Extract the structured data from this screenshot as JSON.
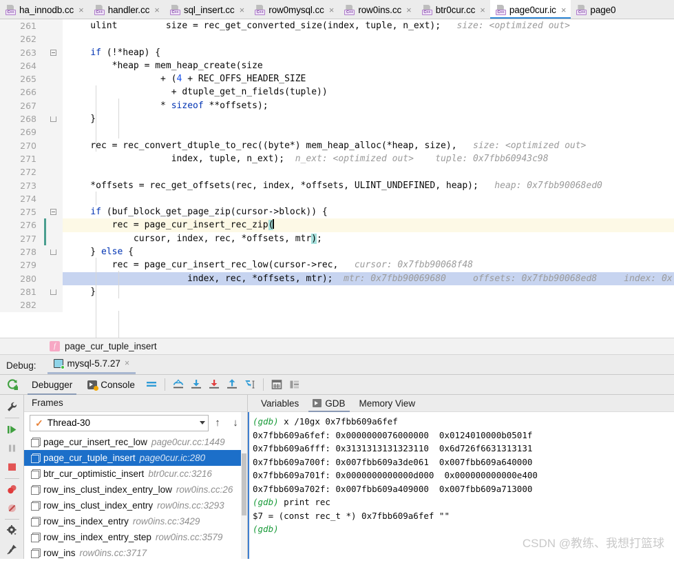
{
  "editor_tabs": [
    {
      "label": "ha_innodb.cc",
      "active": false,
      "closable": true
    },
    {
      "label": "handler.cc",
      "active": false,
      "closable": true
    },
    {
      "label": "sql_insert.cc",
      "active": false,
      "closable": true
    },
    {
      "label": "row0mysql.cc",
      "active": false,
      "closable": true
    },
    {
      "label": "row0ins.cc",
      "active": false,
      "closable": true
    },
    {
      "label": "btr0cur.cc",
      "active": false,
      "closable": true
    },
    {
      "label": "page0cur.ic",
      "active": true,
      "closable": true
    },
    {
      "label": "page0",
      "active": false,
      "closable": false
    }
  ],
  "tab_icon_name": "cpp-file-icon",
  "tab_close_glyph": "×",
  "code": {
    "lines": [
      {
        "n": "261",
        "segments": [
          {
            "t": "    ulint         ",
            "c": "plain"
          },
          {
            "t": "size = rec_get_converted_size(index, tuple, n_ext);",
            "c": "plain"
          },
          {
            "t": "   size: <optimized out>",
            "c": "hint"
          }
        ]
      },
      {
        "n": "262",
        "segments": []
      },
      {
        "n": "263",
        "segments": [
          {
            "t": "    ",
            "c": "plain"
          },
          {
            "t": "if",
            "c": "kw"
          },
          {
            "t": " (!*heap) {",
            "c": "plain"
          }
        ],
        "fold": "open"
      },
      {
        "n": "264",
        "segments": [
          {
            "t": "        *heap = mem_heap_create(size",
            "c": "plain"
          }
        ]
      },
      {
        "n": "265",
        "segments": [
          {
            "t": "                 + (",
            "c": "plain"
          },
          {
            "t": "4",
            "c": "num"
          },
          {
            "t": " + REC_OFFS_HEADER_SIZE",
            "c": "plain"
          }
        ]
      },
      {
        "n": "266",
        "segments": [
          {
            "t": "                   + dtuple_get_n_fields(tuple))",
            "c": "plain"
          }
        ]
      },
      {
        "n": "267",
        "segments": [
          {
            "t": "                 * ",
            "c": "plain"
          },
          {
            "t": "sizeof",
            "c": "kw"
          },
          {
            "t": " **offsets);",
            "c": "plain"
          }
        ]
      },
      {
        "n": "268",
        "segments": [
          {
            "t": "    }",
            "c": "plain"
          }
        ],
        "fold": "end"
      },
      {
        "n": "269",
        "segments": []
      },
      {
        "n": "270",
        "segments": [
          {
            "t": "    rec = rec_convert_dtuple_to_rec((byte*) mem_heap_alloc(*heap, size),",
            "c": "plain"
          },
          {
            "t": "   size: <optimized out>",
            "c": "hint"
          }
        ]
      },
      {
        "n": "271",
        "segments": [
          {
            "t": "                   index, tuple, n_ext);",
            "c": "plain"
          },
          {
            "t": "  n_ext: <optimized out>    tuple: 0x7fbb60943c98",
            "c": "hint"
          }
        ]
      },
      {
        "n": "272",
        "segments": []
      },
      {
        "n": "273",
        "segments": [
          {
            "t": "    *offsets = rec_get_offsets(rec, index, *offsets, ULINT_UNDEFINED, heap);",
            "c": "plain"
          },
          {
            "t": "   heap: 0x7fbb90068ed0",
            "c": "hint"
          }
        ]
      },
      {
        "n": "274",
        "segments": []
      },
      {
        "n": "275",
        "segments": [
          {
            "t": "    ",
            "c": "plain"
          },
          {
            "t": "if",
            "c": "kw"
          },
          {
            "t": " (buf_block_get_page_zip(cursor->block)) {",
            "c": "plain"
          }
        ],
        "fold": "open"
      },
      {
        "n": "276",
        "segments": [
          {
            "t": "        rec = page_cur_insert_rec_zip",
            "c": "plain"
          },
          {
            "t": "(",
            "c": "sel"
          }
        ],
        "hl": "exec",
        "change": true,
        "caret": true
      },
      {
        "n": "277",
        "segments": [
          {
            "t": "            cursor, index, rec, *offsets, mtr",
            "c": "plain"
          },
          {
            "t": ")",
            "c": "sel"
          },
          {
            "t": ";",
            "c": "plain"
          }
        ],
        "change": true
      },
      {
        "n": "278",
        "segments": [
          {
            "t": "    } ",
            "c": "plain"
          },
          {
            "t": "else",
            "c": "kw"
          },
          {
            "t": " {",
            "c": "plain"
          }
        ],
        "fold": "end"
      },
      {
        "n": "279",
        "segments": [
          {
            "t": "        rec = page_cur_insert_rec_low(cursor->rec,",
            "c": "plain"
          },
          {
            "t": "   cursor: 0x7fbb90068f48",
            "c": "hint"
          }
        ]
      },
      {
        "n": "280",
        "segments": [
          {
            "t": "                      index, rec, *offsets, mtr);",
            "c": "plain"
          },
          {
            "t": "  mtr: 0x7fbb90069680     offsets: 0x7fbb90068ed8     index: 0x",
            "c": "hint"
          }
        ],
        "hl": "current"
      },
      {
        "n": "281",
        "segments": [
          {
            "t": "    }",
            "c": "plain"
          }
        ],
        "fold": "end"
      },
      {
        "n": "282",
        "segments": []
      }
    ]
  },
  "breadcrumb": {
    "badge": "f",
    "label": "page_cur_tuple_insert",
    "badge_icon_name": "function-badge-icon"
  },
  "debug_header": {
    "label": "Debug:",
    "run_config": "mysql-5.7.27",
    "close_glyph": "×",
    "run_icon_name": "run-configuration-icon"
  },
  "debug_toolbar": {
    "rerun_icon_name": "rerun-icon",
    "tabs": [
      {
        "label": "Debugger",
        "selected": true,
        "icon": null
      },
      {
        "label": "Console",
        "selected": false,
        "icon": "console-icon"
      }
    ],
    "buttons": [
      {
        "name": "show-execution-point-icon",
        "glyph": "≡"
      },
      {
        "name": "step-over-icon",
        "glyph": "step-over"
      },
      {
        "name": "step-into-icon",
        "glyph": "step-into"
      },
      {
        "name": "force-step-into-icon",
        "glyph": "force-step-into"
      },
      {
        "name": "step-out-icon",
        "glyph": "step-out"
      },
      {
        "name": "run-to-cursor-icon",
        "glyph": "run-to-cursor"
      },
      {
        "name": "evaluate-expression-icon",
        "glyph": "evaluate"
      },
      {
        "name": "layout-settings-icon",
        "glyph": "layout"
      }
    ]
  },
  "rail": {
    "buttons": [
      {
        "name": "settings-wrench-icon"
      },
      {
        "name": "resume-program-icon"
      },
      {
        "name": "pause-program-icon"
      },
      {
        "name": "stop-program-icon"
      },
      {
        "name": "view-breakpoints-icon"
      },
      {
        "name": "mute-breakpoints-icon"
      },
      {
        "name": "debugger-settings-gear-icon"
      },
      {
        "name": "pin-tab-icon"
      }
    ]
  },
  "frames": {
    "title": "Frames",
    "thread": {
      "value": "Thread-30",
      "check_glyph": "✓"
    },
    "nav": {
      "up_glyph": "↑",
      "down_glyph": "↓"
    },
    "items": [
      {
        "name": "page_cur_insert_rec_low",
        "location": "page0cur.cc:1449",
        "selected": false
      },
      {
        "name": "page_cur_tuple_insert",
        "location": "page0cur.ic:280",
        "selected": true
      },
      {
        "name": "btr_cur_optimistic_insert",
        "location": "btr0cur.cc:3216",
        "selected": false
      },
      {
        "name": "row_ins_clust_index_entry_low",
        "location": "row0ins.cc:26",
        "selected": false
      },
      {
        "name": "row_ins_clust_index_entry",
        "location": "row0ins.cc:3293",
        "selected": false
      },
      {
        "name": "row_ins_index_entry",
        "location": "row0ins.cc:3429",
        "selected": false
      },
      {
        "name": "row_ins_index_entry_step",
        "location": "row0ins.cc:3579",
        "selected": false
      },
      {
        "name": "row_ins",
        "location": "row0ins.cc:3717",
        "selected": false
      }
    ]
  },
  "variables": {
    "tabs": [
      {
        "label": "Variables",
        "selected": false,
        "icon": null
      },
      {
        "label": "GDB",
        "selected": true,
        "icon": "gdb-icon"
      },
      {
        "label": "Memory View",
        "selected": false,
        "icon": null
      }
    ],
    "gdb_output": [
      {
        "prompt": "(gdb)",
        "text": " x /10gx 0x7fbb609a6fef"
      },
      {
        "prompt": "",
        "text": "0x7fbb609a6fef: 0x0000000076000000  0x0124010000b0501f"
      },
      {
        "prompt": "",
        "text": "0x7fbb609a6fff: 0x3131313131323110  0x6d726f6631313131"
      },
      {
        "prompt": "",
        "text": "0x7fbb609a700f: 0x007fbb609a3de061  0x007fbb609a640000"
      },
      {
        "prompt": "",
        "text": "0x7fbb609a701f: 0x0000000000000d000  0x000000000000e400"
      },
      {
        "prompt": "",
        "text": "0x7fbb609a702f: 0x007fbb609a409000  0x007fbb609a713000"
      },
      {
        "prompt": "(gdb)",
        "text": " print rec"
      },
      {
        "prompt": "",
        "text": "$7 = (const rec_t *) 0x7fbb609a6fef \"\""
      },
      {
        "prompt": "",
        "text": ""
      },
      {
        "prompt": "(gdb)",
        "text": ""
      }
    ]
  },
  "watermark": "CSDN @教练、我想打篮球",
  "colors": {
    "accent_tab": "#2f87d6",
    "selection_blue": "#1c6fc9",
    "current_line": "#c7d4f0",
    "exec_line": "#fdf9e6",
    "keyword": "#0033b3",
    "hint_gray": "#9a9a9a",
    "gdb_prompt_green": "#1a9b3a",
    "change_marker_teal": "#4a9e8f"
  }
}
